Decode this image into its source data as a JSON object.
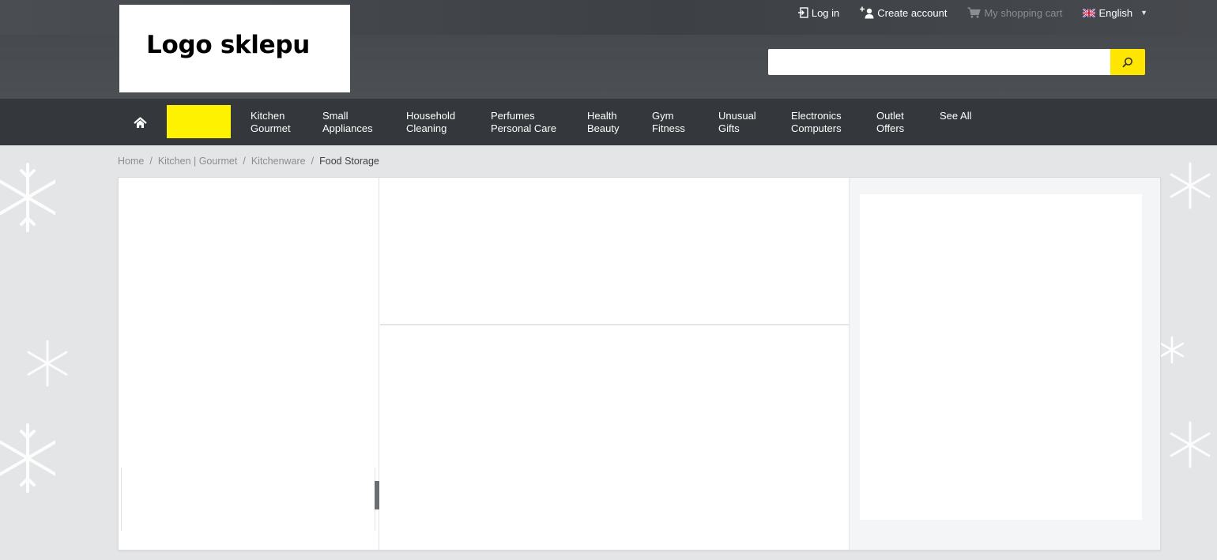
{
  "header": {
    "logo_text": "Logo sklepu",
    "links": {
      "login": "Log in",
      "create_account": "Create account",
      "cart": "My shopping cart",
      "language": "English"
    },
    "search": {
      "value": "",
      "placeholder": ""
    }
  },
  "nav": {
    "items": [
      {
        "line1": "Kitchen",
        "line2": "Gourmet"
      },
      {
        "line1": "Small",
        "line2": "Appliances"
      },
      {
        "line1": "Household",
        "line2": "Cleaning"
      },
      {
        "line1": "Perfumes",
        "line2": "Personal Care"
      },
      {
        "line1": "Health",
        "line2": "Beauty"
      },
      {
        "line1": "Gym",
        "line2": "Fitness"
      },
      {
        "line1": "Unusual",
        "line2": "Gifts"
      },
      {
        "line1": "Electronics",
        "line2": "Computers"
      },
      {
        "line1": "Outlet",
        "line2": "Offers"
      },
      {
        "line1": "See All",
        "line2": ""
      }
    ]
  },
  "breadcrumb": {
    "items": [
      "Home",
      "Kitchen | Gourmet",
      "Kitchenware",
      "Food Storage"
    ],
    "separator": "/"
  },
  "colors": {
    "accent": "#ffe600",
    "header_bg": "#4c5055",
    "nav_bg": "#34373b",
    "page_bg": "#e4e5e7"
  },
  "icons": {
    "login": "login-icon",
    "create_account": "add-user-icon",
    "cart": "cart-icon",
    "language": "uk-flag-icon",
    "search": "search-icon",
    "home": "home-icon"
  }
}
